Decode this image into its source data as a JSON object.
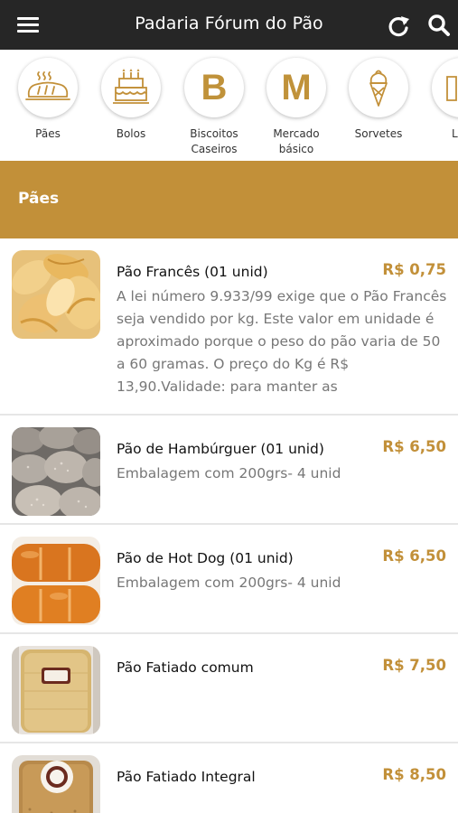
{
  "header": {
    "title": "Padaria Fórum do Pão"
  },
  "categories": [
    {
      "label": "Pães",
      "icon": "bread-icon"
    },
    {
      "label": "Bolos",
      "icon": "cake-icon"
    },
    {
      "label": "Biscoitos Caseiros",
      "letter": "B"
    },
    {
      "label": "Mercado básico",
      "letter": "M"
    },
    {
      "label": "Sorvetes",
      "icon": "ice-cream-icon"
    },
    {
      "label": "Lati",
      "icon": "partial-icon"
    }
  ],
  "section": {
    "title": "Pães"
  },
  "products": [
    {
      "name": "Pão Francês (01 unid)",
      "price": "R$ 0,75",
      "description": "A lei número 9.933/99 exige que o Pão Francês seja vendido por kg. Este valor em unidade é aproximado porque o peso do pão varia de 50 a 60 gramas. O preço do Kg é R$ 13,90.Validade: para manter as"
    },
    {
      "name": "Pão de Hambúrguer (01 unid)",
      "price": "R$ 6,50",
      "description": "Embalagem com 200grs- 4 unid"
    },
    {
      "name": "Pão de Hot Dog (01 unid)",
      "price": "R$ 6,50",
      "description": "Embalagem com 200grs- 4 unid"
    },
    {
      "name": "Pão Fatiado comum",
      "price": "R$ 7,50",
      "description": ""
    },
    {
      "name": "Pão Fatiado Integral",
      "price": "R$ 8,50",
      "description": ""
    }
  ],
  "colors": {
    "header_bg": "#262626",
    "accent": "#C29039",
    "price": "#C29039",
    "muted_text": "#777777"
  }
}
